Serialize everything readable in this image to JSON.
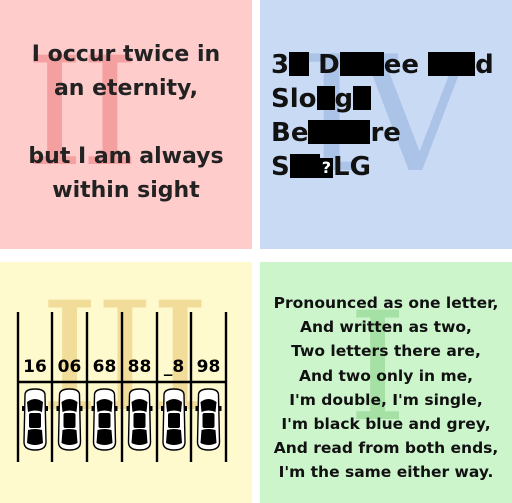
{
  "panels": {
    "top_left": {
      "numeral": "II",
      "lines_a": [
        "I occur twice in",
        "an eternity,"
      ],
      "lines_b": [
        "but I am always",
        "within sight"
      ]
    },
    "top_right": {
      "numeral": "IV",
      "line1_parts": [
        "3",
        "D",
        "ee",
        "d"
      ],
      "line2_parts": [
        "Slo",
        "g"
      ],
      "line3_parts": [
        "Be",
        "re"
      ],
      "line4_parts": [
        "S",
        "?",
        "LG"
      ]
    },
    "bottom_left": {
      "numeral": "III",
      "spots": [
        "16",
        "06",
        "68",
        "88",
        "_8",
        "98"
      ]
    },
    "bottom_right": {
      "numeral": "I",
      "lines": [
        "Pronounced as one letter,",
        "And written as two,",
        "Two letters there are,",
        "And two only in me,",
        "I'm double, I'm single,",
        "I'm black blue and grey,",
        "And read from both ends,",
        "I'm the same either way."
      ]
    }
  }
}
